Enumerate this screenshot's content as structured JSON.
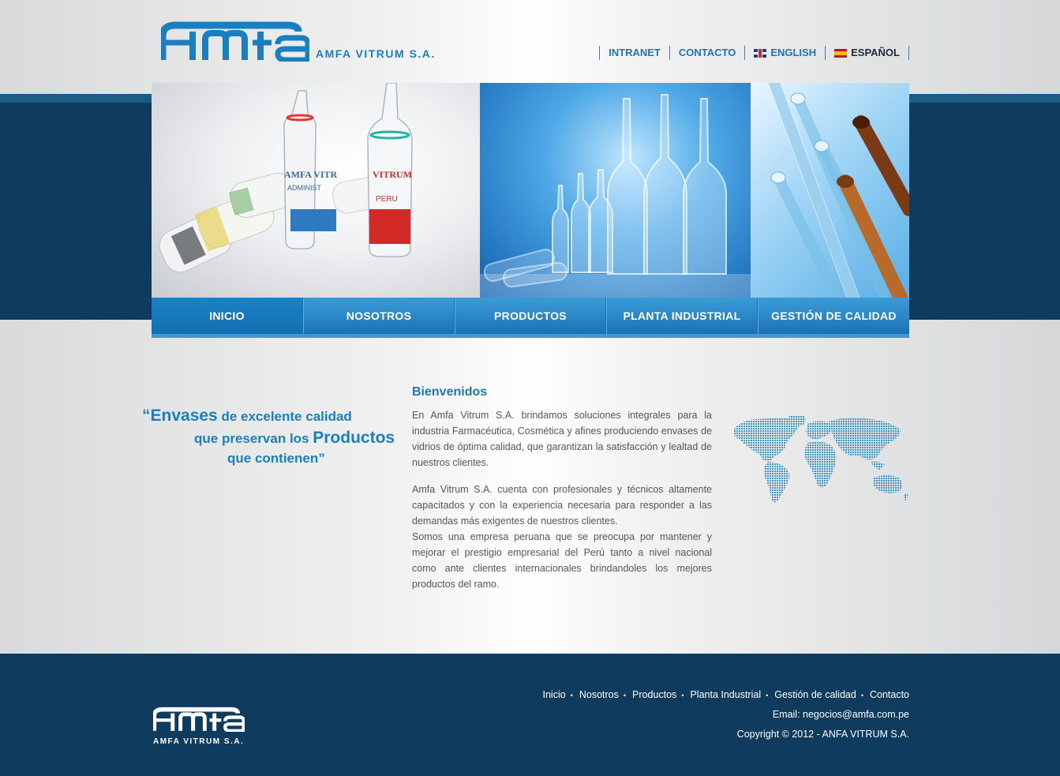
{
  "header": {
    "logo_text": "Amfa",
    "logo_subtitle": "AMFA VITRUM S.A.",
    "links": [
      {
        "label": "INTRANET"
      },
      {
        "label": "CONTACTO"
      },
      {
        "label": "ENGLISH",
        "flag": "uk-flag-icon"
      },
      {
        "label": "ESPAÑOL",
        "flag": "spain-flag-icon"
      }
    ]
  },
  "nav": {
    "items": [
      "INICIO",
      "NOSOTROS",
      "PRODUCTOS",
      "PLANTA INDUSTRIAL",
      "GESTIÓN DE CALIDAD"
    ],
    "active": "INICIO"
  },
  "quote": {
    "w1": "“Envases",
    "w2": " de excelente calidad",
    "w3": "que preservan los ",
    "w4": "Productos",
    "w5": "que contienen”"
  },
  "welcome": {
    "title": "Bienvenidos",
    "p1": "En Amfa Vitrum S.A. brindamos soluciones integrales para la industria Farmacéutica, Cosmética y afines produciendo envases de vidrios de óptima calidad, que garantizan la satisfacción y lealtad de nuestros clientes.",
    "p2": "Amfa Vitrum S.A. cuenta con profesionales y técnicos altamente capacitados y con la experiencia necesaria para responder a las demandas más exigentes de nuestros clientes.",
    "p3": "Somos una empresa peruana que se preocupa por mantener y mejorar el prestigio empresarial del Perú tanto a nivel nacional como ante clientes internacionales brindandoles los mejores productos del ramo."
  },
  "footer": {
    "logo_text": "Amfa",
    "logo_subtitle": "AMFA VITRUM S.A.",
    "links": [
      "Inicio",
      "Nosotros",
      "Productos",
      "Planta Industrial",
      "Gestión de calidad",
      "Contacto"
    ],
    "separator": "•",
    "email": "Email: negocios@amfa.com.pe",
    "copyright": "Copyright © 2012 - ANFA VITRUM S.A."
  },
  "colors": {
    "brand_blue": "#1a7fc0",
    "dark_navy": "#0e3b5e",
    "nav_blue": "#2a86c6"
  }
}
